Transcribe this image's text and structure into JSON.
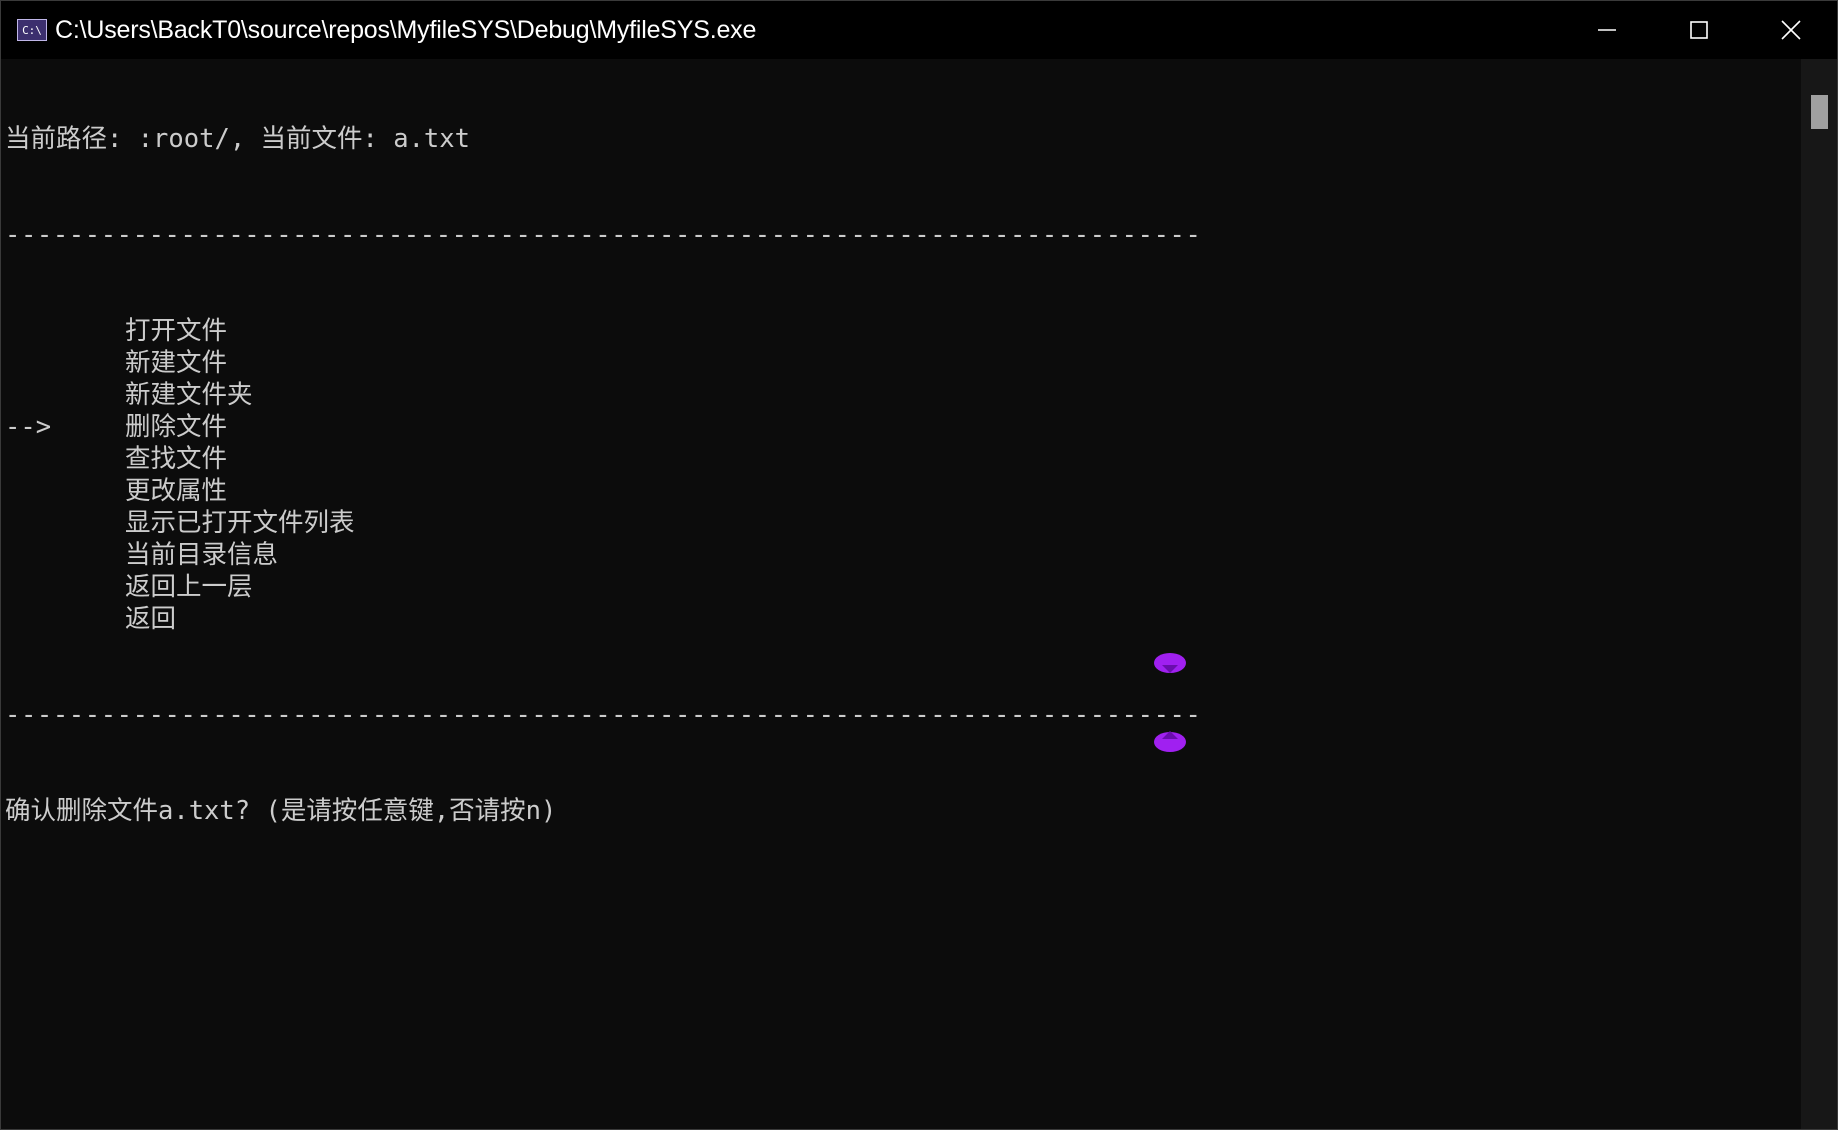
{
  "window": {
    "title": "C:\\Users\\BackT0\\source\\repos\\MyfileSYS\\Debug\\MyfileSYS.exe",
    "icon_label": "C:\\"
  },
  "console": {
    "status_line": "当前路径: :root/, 当前文件: a.txt",
    "divider": "---------------------------------------------------------------------------",
    "arrow": "-->",
    "selected_index": 3,
    "menu_items": [
      "打开文件",
      "新建文件",
      "新建文件夹",
      "删除文件",
      "查找文件",
      "更改属性",
      "显示已打开文件列表",
      "当前目录信息",
      "返回上一层",
      "返回"
    ],
    "prompt": "确认删除文件a.txt? (是请按任意键,否请按n)"
  },
  "colors": {
    "background": "#0c0c0c",
    "text": "#cccccc",
    "titlebar": "#000000",
    "overlay_accent": "#a020f0"
  },
  "icons": {
    "minimize": "minimize-icon",
    "maximize": "maximize-icon",
    "close": "close-icon",
    "app": "console-app-icon"
  }
}
